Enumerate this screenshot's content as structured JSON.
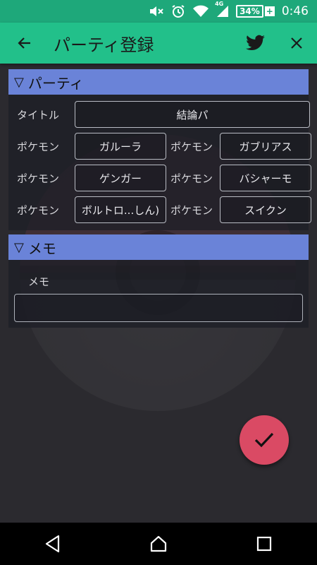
{
  "status_bar": {
    "time": "0:46",
    "battery": "34%",
    "network": "4G"
  },
  "app_bar": {
    "title": "パーティ登録"
  },
  "party_section": {
    "header": "パーティ",
    "title_label": "タイトル",
    "title_value": "結論パ",
    "pokemon_label": "ポケモン",
    "pokemon": [
      "ガルーラ",
      "ガブリアス",
      "ゲンガー",
      "バシャーモ",
      "ボルトロ...しん)",
      "スイクン"
    ]
  },
  "memo_section": {
    "header": "メモ",
    "label": "メモ",
    "value": ""
  },
  "colors": {
    "status_bar": "#1ea87a",
    "app_bar": "#22c08a",
    "section_header": "#6a83d8",
    "fab": "#da4a64",
    "background": "#2b2a2f"
  }
}
